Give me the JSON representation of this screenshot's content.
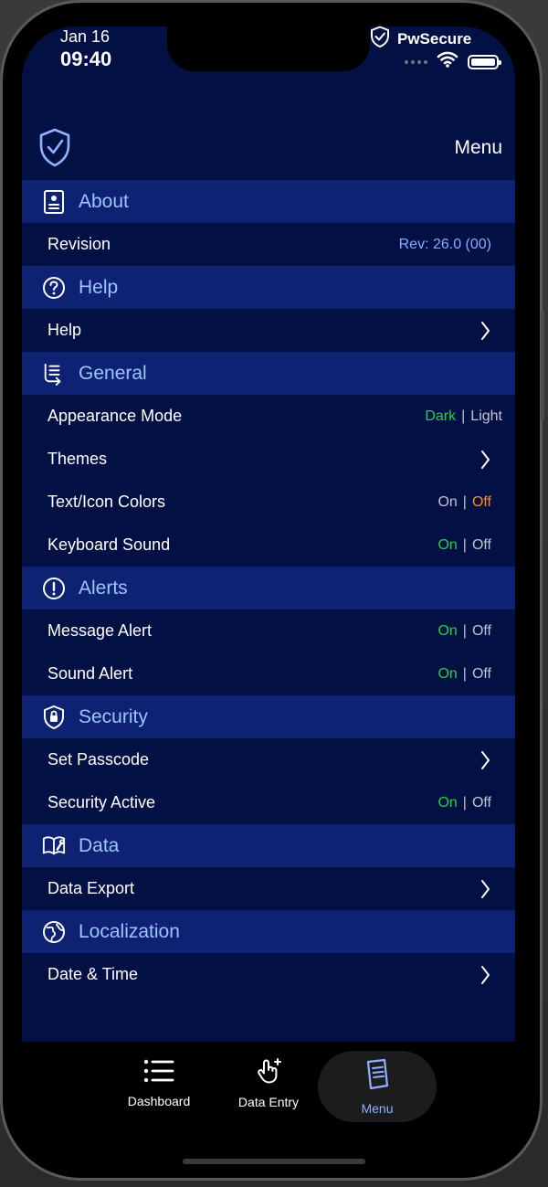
{
  "status_bar": {
    "date": "Jan 16",
    "time": "09:40",
    "app_name": "PwSecure"
  },
  "header": {
    "title": "Menu",
    "logo_icon": "shield-check-icon"
  },
  "colors": {
    "background": "#031044",
    "section_bg": "#0e2274",
    "section_text": "#9cc4ff",
    "value_text": "#8aa9ff",
    "active_green": "#22d14a",
    "active_orange": "#ff8a2a"
  },
  "sections": {
    "about": {
      "title": "About",
      "icon": "id-card-icon",
      "rows": {
        "revision": {
          "label": "Revision",
          "value": "Rev: 26.0 (00)"
        }
      }
    },
    "help": {
      "title": "Help",
      "icon": "question-circle-icon",
      "rows": {
        "help": {
          "label": "Help"
        }
      }
    },
    "general": {
      "title": "General",
      "icon": "list-arrow-icon",
      "rows": {
        "appearance": {
          "label": "Appearance Mode",
          "opt1": "Dark",
          "opt2": "Light",
          "separator": "|"
        },
        "themes": {
          "label": "Themes"
        },
        "text_icon_colors": {
          "label": "Text/Icon Colors",
          "opt1": "On",
          "opt2": "Off",
          "separator": "|"
        },
        "keyboard_sound": {
          "label": "Keyboard Sound",
          "opt1": "On",
          "opt2": "Off",
          "separator": "|"
        }
      }
    },
    "alerts": {
      "title": "Alerts",
      "icon": "exclamation-circle-icon",
      "rows": {
        "message_alert": {
          "label": "Message Alert",
          "opt1": "On",
          "opt2": "Off",
          "separator": "|"
        },
        "sound_alert": {
          "label": "Sound Alert",
          "opt1": "On",
          "opt2": "Off",
          "separator": "|"
        }
      }
    },
    "security": {
      "title": "Security",
      "icon": "shield-lock-icon",
      "rows": {
        "set_passcode": {
          "label": "Set Passcode"
        },
        "security_active": {
          "label": "Security Active",
          "opt1": "On",
          "opt2": "Off",
          "separator": "|"
        }
      }
    },
    "data": {
      "title": "Data",
      "icon": "book-wrench-icon",
      "rows": {
        "data_export": {
          "label": "Data Export"
        }
      }
    },
    "localization": {
      "title": "Localization",
      "icon": "globe-icon",
      "rows": {
        "date_time": {
          "label": "Date & Time"
        }
      }
    }
  },
  "tab_bar": {
    "dashboard": {
      "label": "Dashboard",
      "icon": "list-icon"
    },
    "data_entry": {
      "label": "Data Entry",
      "icon": "hand-tap-icon"
    },
    "menu": {
      "label": "Menu",
      "icon": "document-icon",
      "active": true
    }
  }
}
